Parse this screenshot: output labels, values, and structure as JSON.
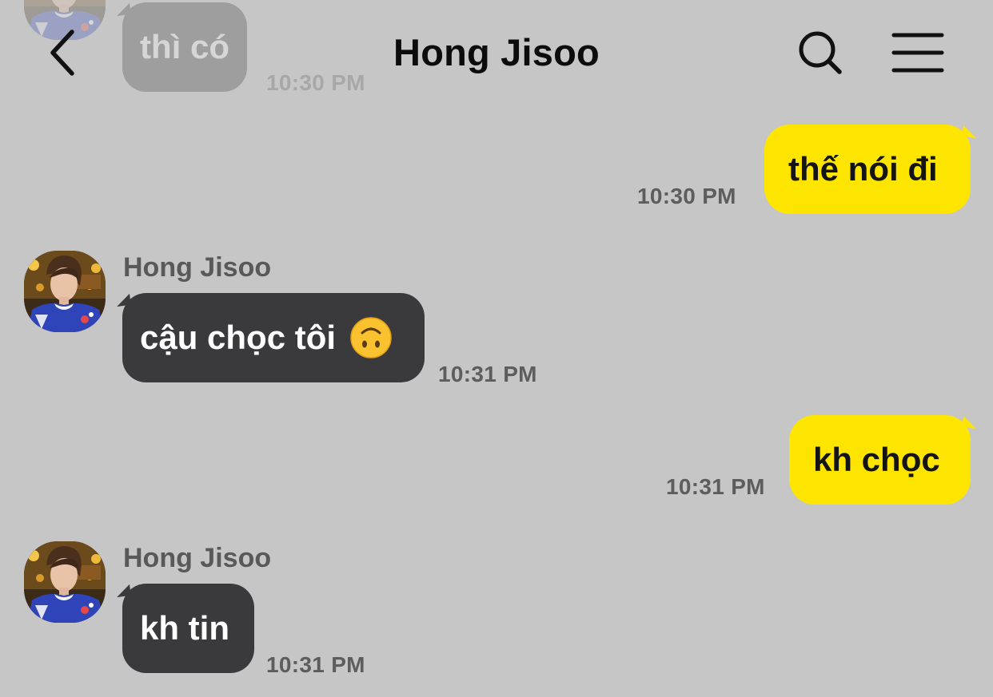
{
  "header": {
    "title": "Hong Jisoo"
  },
  "messages": [
    {
      "direction": "incoming",
      "text": "thì có",
      "time": "10:30 PM"
    },
    {
      "direction": "outgoing",
      "text": "thế nói đi",
      "time": "10:30 PM"
    },
    {
      "direction": "incoming",
      "sender": "Hong Jisoo",
      "text": "cậu chọc tôi",
      "emoji": "upside-down-face",
      "time": "10:31 PM"
    },
    {
      "direction": "outgoing",
      "text": "kh chọc",
      "time": "10:31 PM"
    },
    {
      "direction": "incoming",
      "sender": "Hong Jisoo",
      "text": "kh tin",
      "time": "10:31 PM"
    }
  ],
  "colors": {
    "background": "#c6c6c6",
    "incoming_bubble": "#3a3a3c",
    "outgoing_bubble": "#fee500",
    "timestamp": "#5d5d5d"
  },
  "icons": {
    "back": "chevron-left-icon",
    "search": "search-icon",
    "menu": "hamburger-menu-icon"
  }
}
